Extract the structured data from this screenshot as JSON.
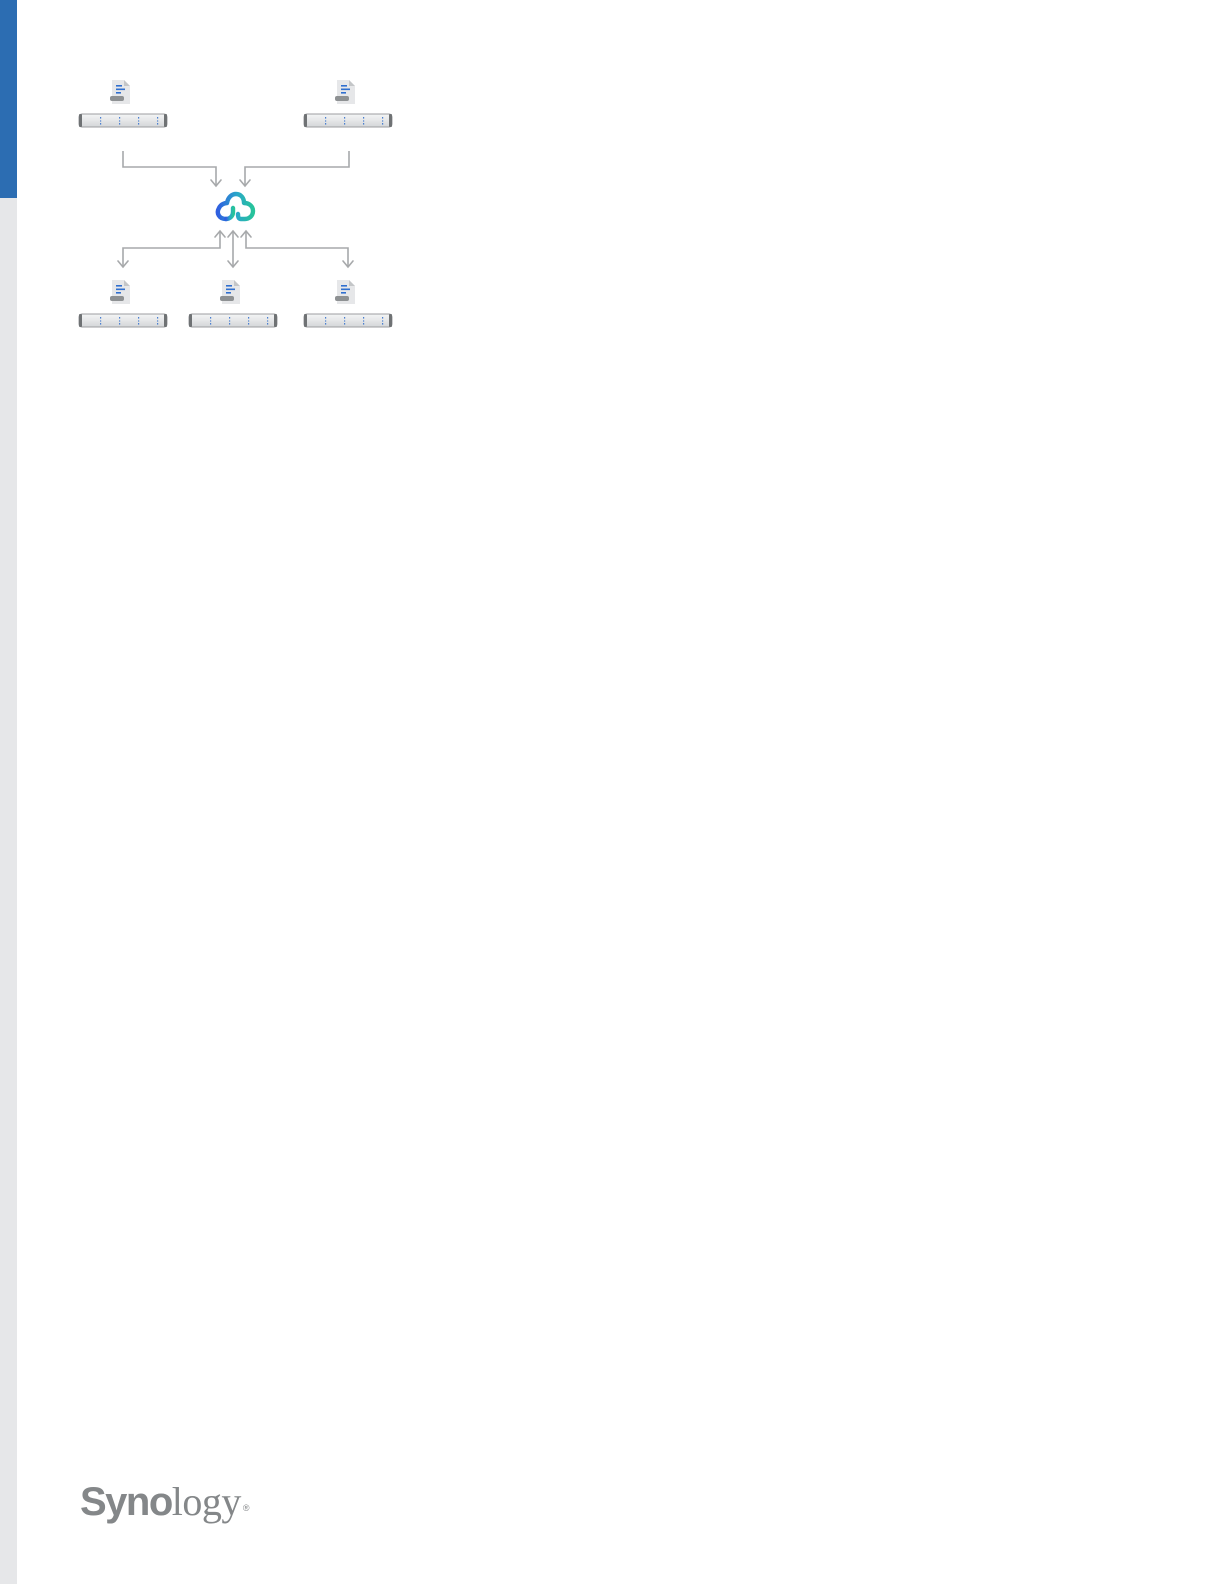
{
  "brand": {
    "name_bold": "Syno",
    "name_light": "logy",
    "registered_mark": "®"
  },
  "diagram": {
    "hub_icon": "cloud-sync-icon",
    "node_icons": [
      "file-icon",
      "rack-server-icon"
    ],
    "upload_sources": 2,
    "sync_targets": 3
  },
  "colors": {
    "sidebar_accent": "#2c6db2",
    "sidebar_rail": "#e6e7e9",
    "connector": "#a7a9ab",
    "cloud_blue": "#2f5fe0",
    "cloud_green": "#27c39a",
    "file_line": "#2f6fcf",
    "logo_gray": "#848789"
  }
}
